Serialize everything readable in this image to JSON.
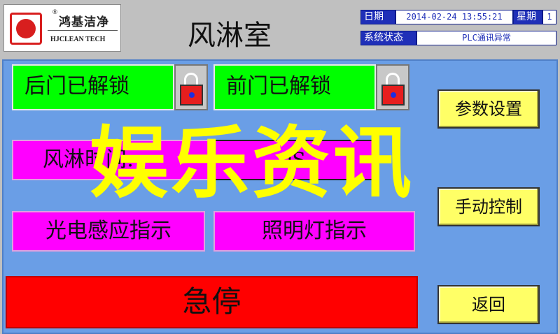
{
  "header": {
    "logo": {
      "brand_cn": "鸿基洁净",
      "brand_en": "HJCLEAN TECH",
      "reg_mark": "®",
      "colors": {
        "mark": "#d81e1e"
      }
    },
    "title": "风淋室",
    "status": {
      "date_label": "日期",
      "datetime": "2014-02-24 13:55:21",
      "weekday_label": "星期",
      "weekday_value": "1",
      "system_label": "系统状态",
      "system_value": "PLC通讯异常"
    }
  },
  "main": {
    "rear_door": {
      "label": "后门已解锁",
      "icon": "padlock-icon"
    },
    "front_door": {
      "label": "前门已解锁",
      "icon": "padlock-icon"
    },
    "timer": {
      "label": "风淋时间:",
      "value": "0S"
    },
    "photo_indicator": {
      "label": "光电感应指示"
    },
    "light_indicator": {
      "label": "照明灯指示"
    },
    "emergency_stop": {
      "label": "急停"
    },
    "buttons": {
      "settings": "参数设置",
      "manual": "手动控制",
      "back": "返回"
    }
  },
  "overlay": {
    "watermark": "娱乐资讯"
  },
  "colors": {
    "background": "#6a9ee6",
    "unlocked": "#00ff00",
    "indicator": "#ff00ff",
    "emergency": "#ff0000",
    "button": "#ffff66",
    "status_blue": "#1f2fb8",
    "watermark": "#ffff00"
  }
}
